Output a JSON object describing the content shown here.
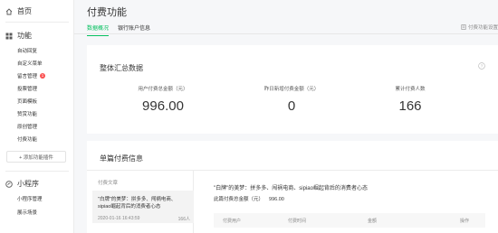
{
  "sidebar": {
    "home_label": "首页",
    "function_label": "功能",
    "items": [
      {
        "label": "自动回复"
      },
      {
        "label": "自定义菜单"
      },
      {
        "label": "留言管理",
        "badge": "1"
      },
      {
        "label": "投票管理"
      },
      {
        "label": "页面模板"
      },
      {
        "label": "赞赏功能"
      },
      {
        "label": "原创管理"
      },
      {
        "label": "付费功能"
      }
    ],
    "add_plugin_label": "+ 添加功能插件",
    "miniprogram_label": "小程序",
    "mini_items": [
      {
        "label": "小程序管理"
      },
      {
        "label": "展示场景"
      }
    ]
  },
  "header": {
    "title": "付费功能",
    "tabs": [
      {
        "label": "数据概况",
        "active": true
      },
      {
        "label": "银行账户信息",
        "active": false
      }
    ],
    "settings_link": "付费功能设置"
  },
  "summary": {
    "title": "整体汇总数据",
    "stats": [
      {
        "label": "用户付费总金额（元）",
        "value": "996.00"
      },
      {
        "label": "昨日新增付费金额（元）",
        "value": "0"
      },
      {
        "label": "累计付费人数",
        "value": "166"
      }
    ]
  },
  "single": {
    "title": "单篇付费信息",
    "list_header": "付费文章",
    "article": {
      "title": "\"白牌\"的美梦：拼多多、闯祸电商、sipiao崛起背后的消费者心态",
      "date": "2020-01-16 16:43:59",
      "count": "166人"
    },
    "detail_title": "\"白牌\"的美梦：拼多多、闯祸电商、sipiao崛起背后的消费者心态",
    "detail_sum_label": "此篇付费总金额（元）",
    "detail_sum_value": "996.00",
    "table_headers": [
      "付费用户",
      "付费时间",
      "金额",
      "操作"
    ]
  },
  "colors": {
    "accent": "#07c160",
    "badge": "#fa5151"
  }
}
